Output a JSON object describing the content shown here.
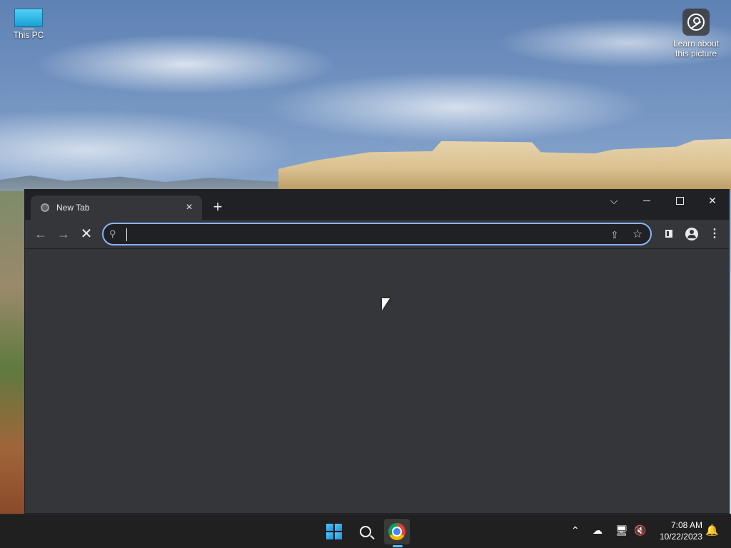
{
  "desktop": {
    "icons": [
      {
        "label": "This PC"
      },
      {
        "label": "Learn about this picture"
      }
    ]
  },
  "browser": {
    "tab": {
      "title": "New Tab"
    },
    "new_tab_symbol": "+",
    "omnibox": {
      "value": ""
    }
  },
  "taskbar": {
    "time": "7:08 AM",
    "date": "10/22/2023"
  },
  "colors": {
    "omnibox_focus": "#8ab4f8",
    "browser_bg": "#35363a",
    "titlebar_bg": "#202124",
    "taskbar_bg": "#202020",
    "accent": "#4cc2ff"
  }
}
